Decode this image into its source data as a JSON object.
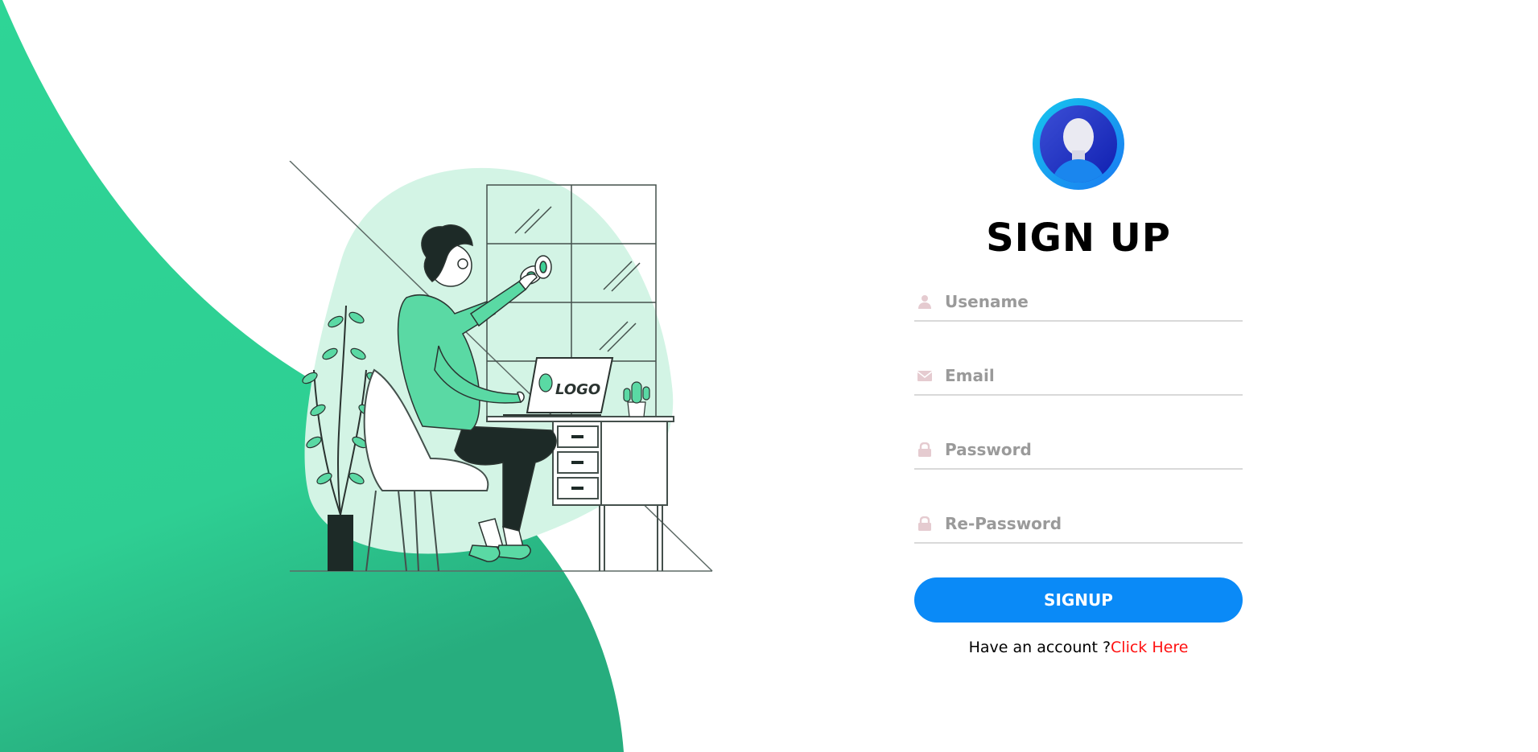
{
  "brand": {
    "accent": "#2ecf93",
    "button": "#0a8af7",
    "link": "#ff1010"
  },
  "illustration": {
    "laptop_logo_text": "LOGO"
  },
  "form": {
    "title": "SIGN UP",
    "avatar_icon": "user-avatar-icon",
    "fields": [
      {
        "icon": "user-icon",
        "placeholder": "Usename",
        "value": ""
      },
      {
        "icon": "envelope-icon",
        "placeholder": "Email",
        "value": ""
      },
      {
        "icon": "lock-icon",
        "placeholder": "Password",
        "value": ""
      },
      {
        "icon": "lock-icon",
        "placeholder": "Re-Password",
        "value": ""
      }
    ],
    "submit_label": "SIGNUP",
    "account_prompt": "Have an account ?",
    "account_link": "Click Here"
  }
}
